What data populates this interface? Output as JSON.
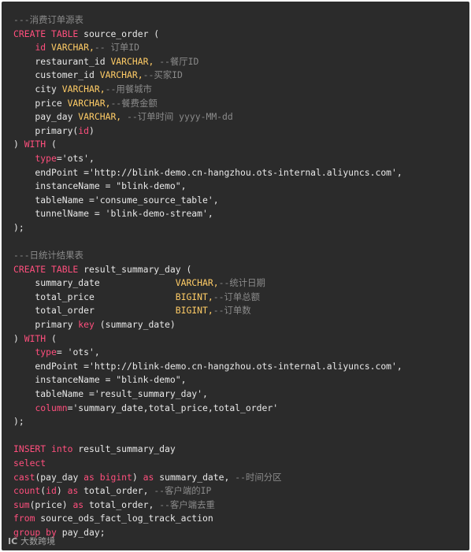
{
  "colors": {
    "background": "#2b2b2b",
    "keyword": "#ff4f7d",
    "type": "#ffcc66",
    "text": "#e8e8e8",
    "comment": "#8a8a8a"
  },
  "code": [
    [
      {
        "t": "com",
        "v": "---消费订单源表"
      }
    ],
    [
      {
        "t": "kw",
        "v": "CREATE TABLE"
      },
      {
        "t": "txt",
        "v": " source_order ("
      }
    ],
    [
      {
        "t": "txt",
        "v": "    "
      },
      {
        "t": "kw",
        "v": "id"
      },
      {
        "t": "txt",
        "v": " "
      },
      {
        "t": "typ",
        "v": "VARCHAR,"
      },
      {
        "t": "com",
        "v": "-- 订单ID"
      }
    ],
    [
      {
        "t": "txt",
        "v": "    restaurant_id "
      },
      {
        "t": "typ",
        "v": "VARCHAR,"
      },
      {
        "t": "txt",
        "v": " "
      },
      {
        "t": "com",
        "v": "--餐厅ID"
      }
    ],
    [
      {
        "t": "txt",
        "v": "    customer_id "
      },
      {
        "t": "typ",
        "v": "VARCHAR,"
      },
      {
        "t": "com",
        "v": "--买家ID"
      }
    ],
    [
      {
        "t": "txt",
        "v": "    city "
      },
      {
        "t": "typ",
        "v": "VARCHAR,"
      },
      {
        "t": "com",
        "v": "--用餐城市"
      }
    ],
    [
      {
        "t": "txt",
        "v": "    price "
      },
      {
        "t": "typ",
        "v": "VARCHAR,"
      },
      {
        "t": "com",
        "v": "--餐费金额"
      }
    ],
    [
      {
        "t": "txt",
        "v": "    pay_day "
      },
      {
        "t": "typ",
        "v": "VARCHAR,"
      },
      {
        "t": "txt",
        "v": " "
      },
      {
        "t": "com",
        "v": "--订单时间 yyyy-MM-dd"
      }
    ],
    [
      {
        "t": "txt",
        "v": "    primary("
      },
      {
        "t": "kw",
        "v": "id"
      },
      {
        "t": "txt",
        "v": ")"
      }
    ],
    [
      {
        "t": "txt",
        "v": ") "
      },
      {
        "t": "kw",
        "v": "WITH"
      },
      {
        "t": "txt",
        "v": " ("
      }
    ],
    [
      {
        "t": "txt",
        "v": "    "
      },
      {
        "t": "kw",
        "v": "type"
      },
      {
        "t": "txt",
        "v": "='ots',"
      }
    ],
    [
      {
        "t": "txt",
        "v": "    endPoint ='http://blink-demo.cn-hangzhou.ots-internal.aliyuncs.com',"
      }
    ],
    [
      {
        "t": "txt",
        "v": "    instanceName = \"blink-demo\","
      }
    ],
    [
      {
        "t": "txt",
        "v": "    tableName ='consume_source_table',"
      }
    ],
    [
      {
        "t": "txt",
        "v": "    tunnelName = 'blink-demo-stream',"
      }
    ],
    [
      {
        "t": "txt",
        "v": ");"
      }
    ],
    [
      {
        "t": "txt",
        "v": ""
      }
    ],
    [
      {
        "t": "com",
        "v": "---日统计结果表"
      }
    ],
    [
      {
        "t": "kw",
        "v": "CREATE TABLE"
      },
      {
        "t": "txt",
        "v": " result_summary_day ("
      }
    ],
    [
      {
        "t": "txt",
        "v": "    summary_date              "
      },
      {
        "t": "typ",
        "v": "VARCHAR,"
      },
      {
        "t": "com",
        "v": "--统计日期"
      }
    ],
    [
      {
        "t": "txt",
        "v": "    total_price               "
      },
      {
        "t": "typ",
        "v": "BIGINT,"
      },
      {
        "t": "com",
        "v": "--订单总额"
      }
    ],
    [
      {
        "t": "txt",
        "v": "    total_order               "
      },
      {
        "t": "typ",
        "v": "BIGINT,"
      },
      {
        "t": "com",
        "v": "--订单数"
      }
    ],
    [
      {
        "t": "txt",
        "v": "    primary "
      },
      {
        "t": "kw",
        "v": "key"
      },
      {
        "t": "txt",
        "v": " (summary_date)"
      }
    ],
    [
      {
        "t": "txt",
        "v": ") "
      },
      {
        "t": "kw",
        "v": "WITH"
      },
      {
        "t": "txt",
        "v": " ("
      }
    ],
    [
      {
        "t": "txt",
        "v": "    "
      },
      {
        "t": "kw",
        "v": "type"
      },
      {
        "t": "txt",
        "v": "= 'ots',"
      }
    ],
    [
      {
        "t": "txt",
        "v": "    endPoint ='http://blink-demo.cn-hangzhou.ots-internal.aliyuncs.com',"
      }
    ],
    [
      {
        "t": "txt",
        "v": "    instanceName = \"blink-demo\","
      }
    ],
    [
      {
        "t": "txt",
        "v": "    tableName ='result_summary_day',"
      }
    ],
    [
      {
        "t": "txt",
        "v": "    "
      },
      {
        "t": "kw",
        "v": "column"
      },
      {
        "t": "txt",
        "v": "='summary_date,total_price,total_order'"
      }
    ],
    [
      {
        "t": "txt",
        "v": ");"
      }
    ],
    [
      {
        "t": "txt",
        "v": ""
      }
    ],
    [
      {
        "t": "kw",
        "v": "INSERT into"
      },
      {
        "t": "txt",
        "v": " result_summary_day"
      }
    ],
    [
      {
        "t": "kw",
        "v": "select"
      }
    ],
    [
      {
        "t": "kw",
        "v": "cast"
      },
      {
        "t": "txt",
        "v": "(pay_day "
      },
      {
        "t": "kw",
        "v": "as"
      },
      {
        "t": "txt",
        "v": " "
      },
      {
        "t": "kw",
        "v": "bigint"
      },
      {
        "t": "txt",
        "v": ") "
      },
      {
        "t": "kw",
        "v": "as"
      },
      {
        "t": "txt",
        "v": " summary_date, "
      },
      {
        "t": "com",
        "v": "--时间分区"
      }
    ],
    [
      {
        "t": "kw",
        "v": "count"
      },
      {
        "t": "txt",
        "v": "("
      },
      {
        "t": "kw",
        "v": "id"
      },
      {
        "t": "txt",
        "v": ") "
      },
      {
        "t": "kw",
        "v": "as"
      },
      {
        "t": "txt",
        "v": " total_order, "
      },
      {
        "t": "com",
        "v": "--客户端的IP"
      }
    ],
    [
      {
        "t": "kw",
        "v": "sum"
      },
      {
        "t": "txt",
        "v": "(price) "
      },
      {
        "t": "kw",
        "v": "as"
      },
      {
        "t": "txt",
        "v": " total_order, "
      },
      {
        "t": "com",
        "v": "--客户端去重"
      }
    ],
    [
      {
        "t": "kw",
        "v": "from"
      },
      {
        "t": "txt",
        "v": " source_ods_fact_log_track_action"
      }
    ],
    [
      {
        "t": "kw",
        "v": "group by"
      },
      {
        "t": "txt",
        "v": " pay_day;"
      }
    ]
  ],
  "watermark": {
    "logo": "IC",
    "text": "大数跨境"
  }
}
